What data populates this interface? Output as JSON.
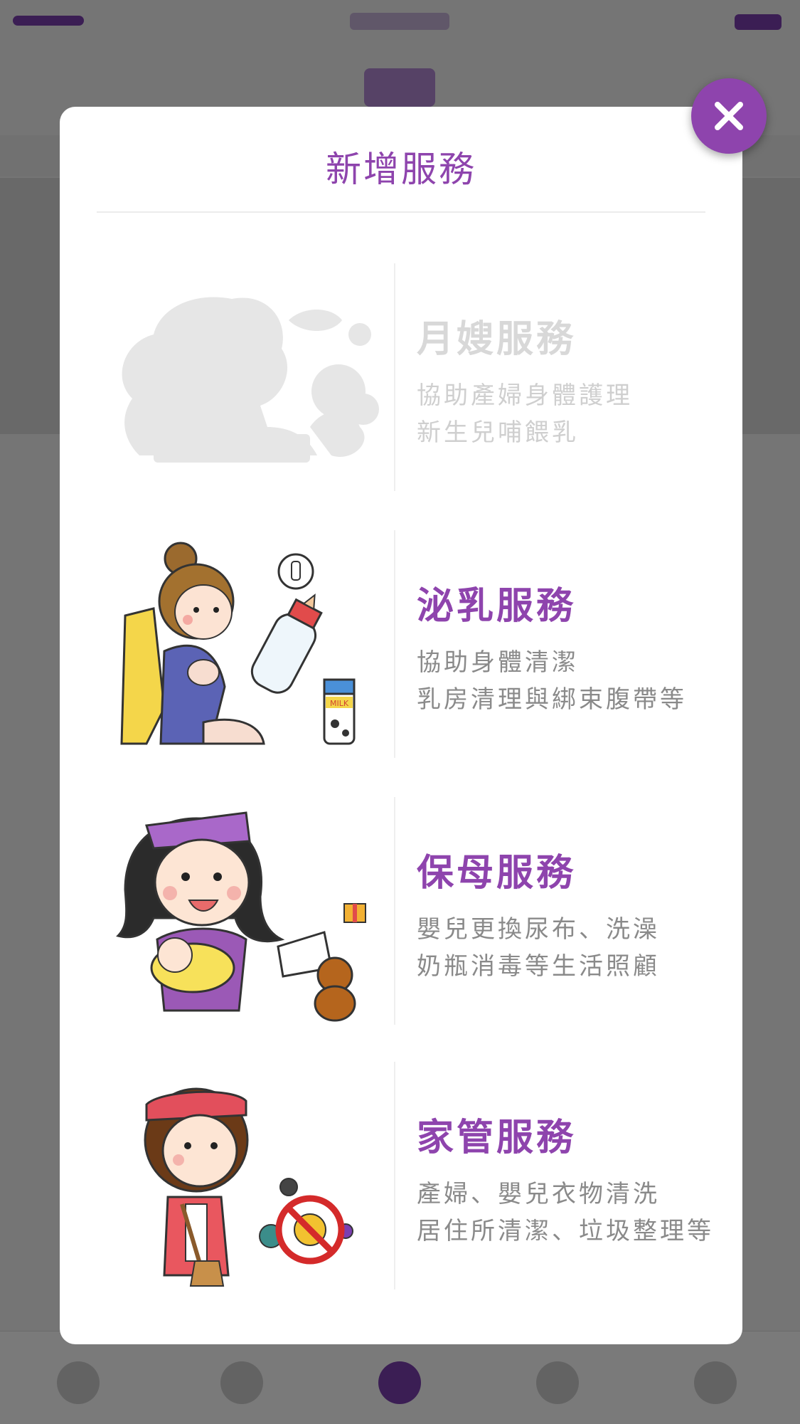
{
  "modal": {
    "title": "新增服務",
    "close_icon": "close-icon"
  },
  "services": [
    {
      "name": "月嫂服務",
      "desc_line1": "協助產婦身體護理",
      "desc_line2": "新生兒哺餵乳",
      "state": "disabled",
      "icon": "mother-silhouette-illustration"
    },
    {
      "name": "泌乳服務",
      "desc_line1": "協助身體清潔",
      "desc_line2": "乳房清理與綁束腹帶等",
      "state": "enabled",
      "icon": "breastfeeding-mother-illustration",
      "milk_label": "MILK"
    },
    {
      "name": "保母服務",
      "desc_line1": "嬰兒更換尿布、洗澡",
      "desc_line2": "奶瓶消毒等生活照顧",
      "state": "enabled",
      "icon": "nanny-with-baby-illustration"
    },
    {
      "name": "家管服務",
      "desc_line1": "產婦、嬰兒衣物清洗",
      "desc_line2": "居住所清潔、垃圾整理等",
      "state": "enabled",
      "icon": "housekeeper-with-broom-illustration"
    }
  ],
  "colors": {
    "accent": "#8e44ad",
    "disabled_text": "#d8d8d8",
    "desc_text": "#8a8a8a"
  }
}
